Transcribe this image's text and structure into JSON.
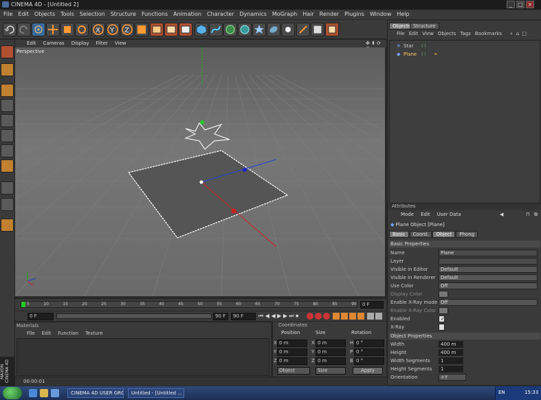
{
  "window": {
    "title": "CINEMA 4D - [Untitled 2]"
  },
  "menu": [
    "File",
    "Edit",
    "Objects",
    "Tools",
    "Selection",
    "Structure",
    "Functions",
    "Animation",
    "Character",
    "Dynamics",
    "MoGraph",
    "Hair",
    "Render",
    "Plugins",
    "Window",
    "Help"
  ],
  "viewport": {
    "menu": [
      "Edit",
      "Cameras",
      "Display",
      "Filter",
      "View"
    ],
    "label": "Perspective"
  },
  "timeline": {
    "ticks": [
      "0",
      "5",
      "10",
      "15",
      "20",
      "25",
      "30",
      "35",
      "40",
      "45",
      "50",
      "55",
      "60",
      "65",
      "70",
      "75",
      "80",
      "85",
      "90"
    ],
    "current_frame": "0 F",
    "start": "0 F",
    "end": "90 F",
    "end2": "90 F"
  },
  "materials": {
    "title": "Materials",
    "menu": [
      "File",
      "Edit",
      "Function",
      "Texture"
    ]
  },
  "coordinates": {
    "title": "Coordinates",
    "headers": [
      "Position",
      "Size",
      "Rotation"
    ],
    "rows": [
      {
        "axis": "X",
        "pos": "0 m",
        "size_axis": "X",
        "size": "0 m",
        "rot_axis": "H",
        "rot": "0 °"
      },
      {
        "axis": "Y",
        "pos": "0 m",
        "size_axis": "Y",
        "size": "0 m",
        "rot_axis": "P",
        "rot": "0 °"
      },
      {
        "axis": "Z",
        "pos": "0 m",
        "size_axis": "Z",
        "size": "0 m",
        "rot_axis": "B",
        "rot": "0 °"
      }
    ],
    "mode": "Object",
    "size_mode": "Size",
    "apply": "Apply"
  },
  "status": {
    "time": "00:00:01"
  },
  "objects_panel": {
    "tabs": [
      "Objects",
      "Structure"
    ],
    "menu": [
      "File",
      "Edit",
      "View",
      "Objects",
      "Tags",
      "Bookmarks"
    ],
    "items": [
      {
        "name": "Star"
      },
      {
        "name": "Plane"
      }
    ]
  },
  "attributes": {
    "header": "Attributes",
    "menu": [
      "Mode",
      "Edit",
      "User Data"
    ],
    "object_title": "Plane Object [Plane]",
    "tabs": [
      "Basic",
      "Coord.",
      "Object",
      "Phong"
    ],
    "basic_title": "Basic Properties",
    "basic": [
      {
        "label": "Name",
        "value": "Plane"
      },
      {
        "label": "Layer",
        "value": ""
      },
      {
        "label": "Visible in Editor",
        "value": "Default"
      },
      {
        "label": "Visible in Renderer",
        "value": "Default"
      },
      {
        "label": "Use Color",
        "value": "Off"
      },
      {
        "label": "Display Color",
        "value": ""
      },
      {
        "label": "Enable X-Ray mode",
        "value": "Off"
      },
      {
        "label": "Enable X-Ray Color",
        "value": ""
      },
      {
        "label": "Enabled",
        "value": ""
      },
      {
        "label": "X-Ray",
        "value": ""
      }
    ],
    "object_props_title": "Object Properties",
    "object_props": [
      {
        "label": "Width",
        "value": "400 m"
      },
      {
        "label": "Height",
        "value": "400 m"
      },
      {
        "label": "Width Segments",
        "value": "1"
      },
      {
        "label": "Height Segments",
        "value": "1"
      },
      {
        "label": "Orientation",
        "value": "+Y"
      }
    ]
  },
  "taskbar": {
    "tasks": [
      "CINEMA 4D USER GROUP...",
      "Untitled - [Untitled ..."
    ],
    "lang": "EN",
    "clock": "15:33"
  },
  "colors": {
    "accent": "#2d5b9a",
    "axis_x": "#cc2222",
    "axis_y": "#22aa22",
    "axis_z": "#2244cc"
  }
}
